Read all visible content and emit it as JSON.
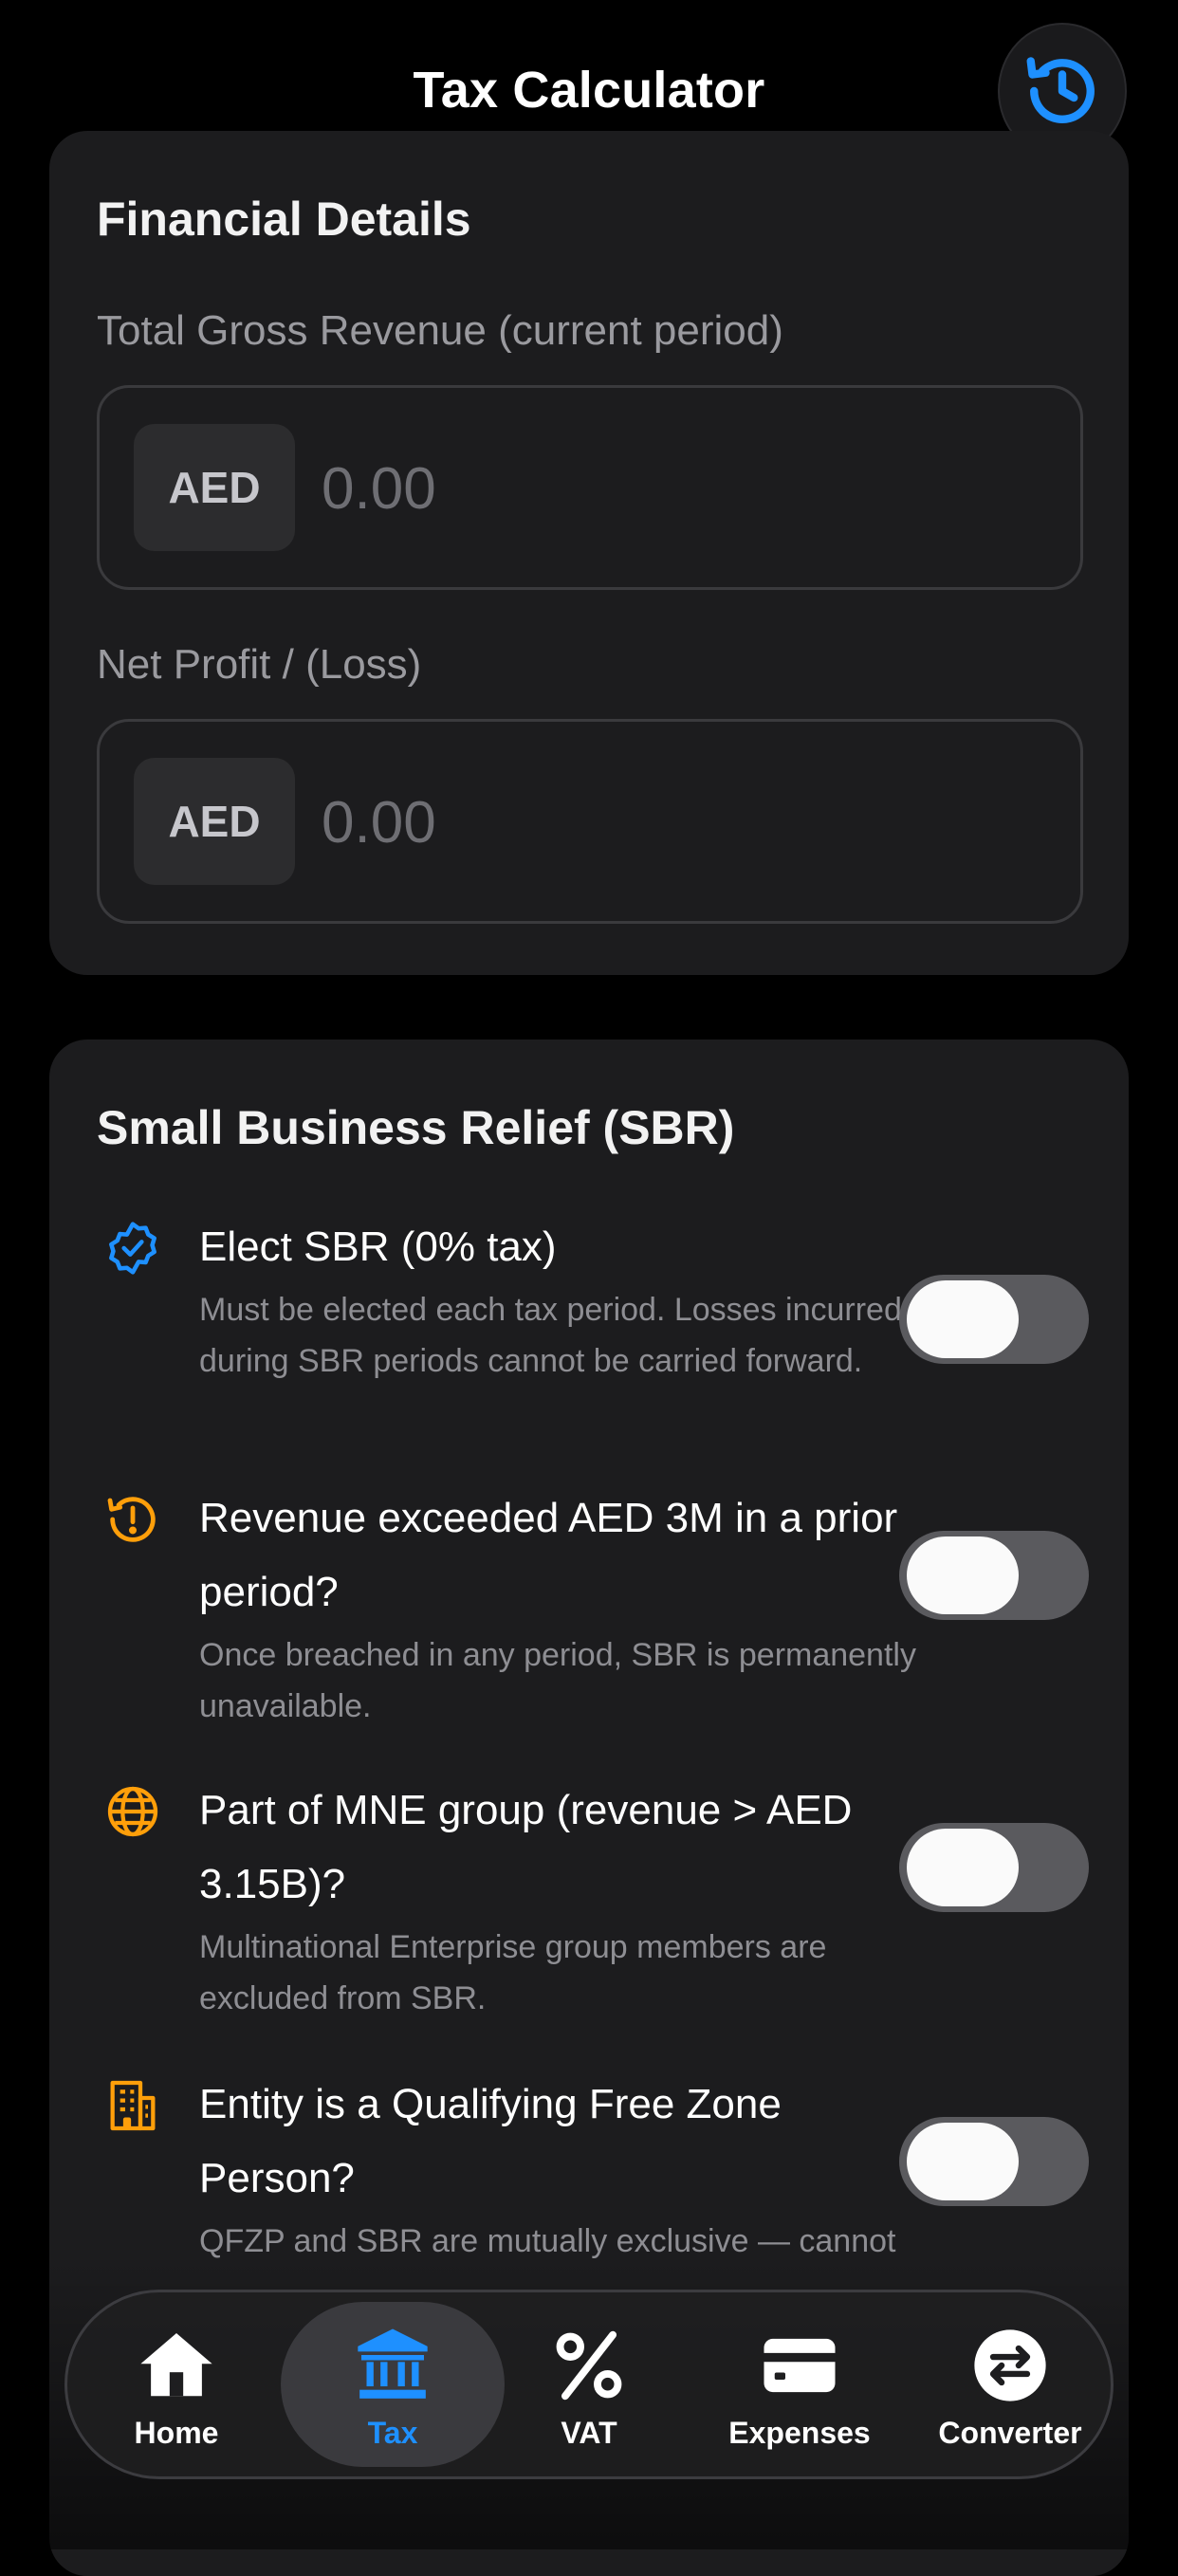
{
  "header": {
    "title": "Tax Calculator",
    "history_icon": "history-clock-icon"
  },
  "financial": {
    "title": "Financial Details",
    "revenue": {
      "label": "Total Gross Revenue (current period)",
      "currency": "AED",
      "value": "",
      "placeholder": "0.00"
    },
    "profit": {
      "label": "Net Profit / (Loss)",
      "currency": "AED",
      "value": "",
      "placeholder": "0.00"
    }
  },
  "sbr": {
    "title": "Small Business Relief (SBR)",
    "items": [
      {
        "icon": "verified-badge-icon",
        "color": "#1e90ff",
        "title": "Elect SBR (0% tax)",
        "desc": "Must be elected each tax period. Losses incurred during SBR periods cannot be carried forward.",
        "on": false
      },
      {
        "icon": "history-alert-icon",
        "color": "#ff9f0a",
        "title": "Revenue exceeded AED 3M in a prior period?",
        "desc": "Once breached in any period, SBR is permanently unavailable.",
        "on": false
      },
      {
        "icon": "globe-icon",
        "color": "#ff9f0a",
        "title": "Part of MNE group (revenue > AED 3.15B)?",
        "desc": "Multinational Enterprise group members are excluded from SBR.",
        "on": false
      },
      {
        "icon": "building-icon",
        "color": "#ff9f0a",
        "title": "Entity is a Qualifying Free Zone Person?",
        "desc": "QFZP and SBR are mutually exclusive — cannot claim both.",
        "on": false
      }
    ]
  },
  "tabs": [
    {
      "label": "Home",
      "icon": "home-icon",
      "active": false
    },
    {
      "label": "Tax",
      "icon": "bank-icon",
      "active": true
    },
    {
      "label": "VAT",
      "icon": "percent-icon",
      "active": false
    },
    {
      "label": "Expenses",
      "icon": "card-icon",
      "active": false
    },
    {
      "label": "Converter",
      "icon": "swap-icon",
      "active": false
    }
  ],
  "colors": {
    "accent": "#1e90ff",
    "warning": "#ff9f0a",
    "card": "#1c1c1e"
  }
}
